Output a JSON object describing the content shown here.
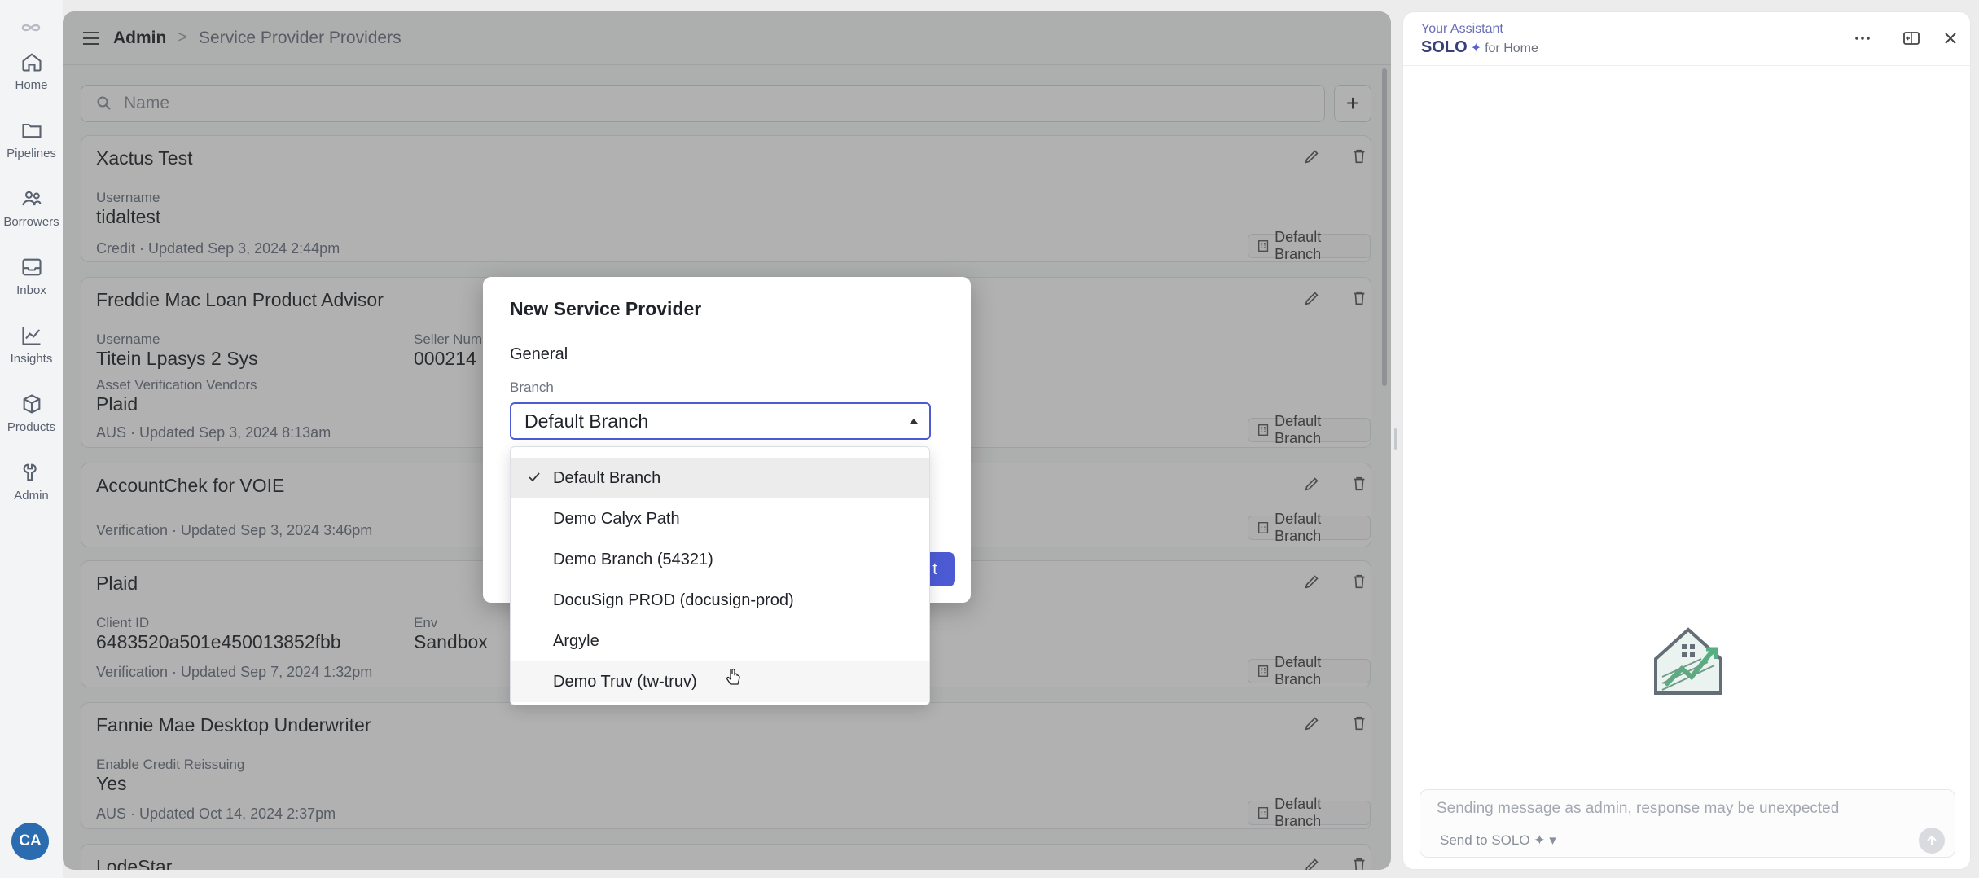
{
  "nav": {
    "items": [
      {
        "label": "Home",
        "icon": "home-icon"
      },
      {
        "label": "Pipelines",
        "icon": "folder-icon"
      },
      {
        "label": "Borrowers",
        "icon": "people-icon"
      },
      {
        "label": "Inbox",
        "icon": "inbox-icon"
      },
      {
        "label": "Insights",
        "icon": "chart-icon"
      },
      {
        "label": "Products",
        "icon": "box-icon"
      },
      {
        "label": "Admin",
        "icon": "wrench-icon"
      }
    ],
    "avatar": "CA"
  },
  "header": {
    "breadcrumb_root": "Admin",
    "breadcrumb_sep": ">",
    "page_title": "Service Provider Providers"
  },
  "search": {
    "placeholder": "Name"
  },
  "cards": [
    {
      "name": "Xactus Test",
      "fields": [
        {
          "label": "Username",
          "value": "tidaltest"
        }
      ],
      "meta": "Credit · Updated Sep 3, 2024 2:44pm",
      "branch": "Default Branch"
    },
    {
      "name": "Freddie Mac Loan Product Advisor",
      "fields": [
        {
          "label": "Username",
          "value": "Titein Lpasys 2 Sys"
        },
        {
          "label": "Seller Num",
          "value": "000214"
        },
        {
          "label": "Asset Verification Vendors",
          "value": "Plaid"
        }
      ],
      "meta": "AUS · Updated Sep 3, 2024 8:13am",
      "branch": "Default Branch"
    },
    {
      "name": "AccountChek for VOIE",
      "fields": [],
      "meta": "Verification · Updated Sep 3, 2024 3:46pm",
      "branch": "Default Branch"
    },
    {
      "name": "Plaid",
      "fields": [
        {
          "label": "Client ID",
          "value": "6483520a501e450013852fbb"
        },
        {
          "label": "Env",
          "value": "Sandbox"
        }
      ],
      "meta": "Verification · Updated Sep 7, 2024 1:32pm",
      "branch": "Default Branch"
    },
    {
      "name": "Fannie Mae Desktop Underwriter",
      "fields": [
        {
          "label": "Enable Credit Reissuing",
          "value": "Yes"
        }
      ],
      "meta": "AUS · Updated Oct 14, 2024 2:37pm",
      "branch": "Default Branch"
    },
    {
      "name": "LodeStar",
      "fields": [],
      "meta": "",
      "branch": ""
    }
  ],
  "modal": {
    "title": "New Service Provider",
    "section": "General",
    "branch_label": "Branch",
    "branch_value": "Default Branch",
    "button_partial": "t"
  },
  "dropdown": {
    "options": [
      "Default Branch",
      "Demo Calyx Path",
      "Demo Branch (54321)",
      "DocuSign PROD (docusign-prod)",
      "Argyle",
      "Demo Truv (tw-truv)"
    ],
    "selected_index": 0,
    "hover_index": 5
  },
  "assistant": {
    "subtitle": "Your Assistant",
    "title": "SOLO",
    "spark": "✦",
    "context": "for Home",
    "input_placeholder": "Sending message as admin, response may be unexpected",
    "send_to": "Send to SOLO ✦ ▾"
  },
  "colors": {
    "accent": "#4c5bd4",
    "avatar": "#2b6cb0"
  }
}
